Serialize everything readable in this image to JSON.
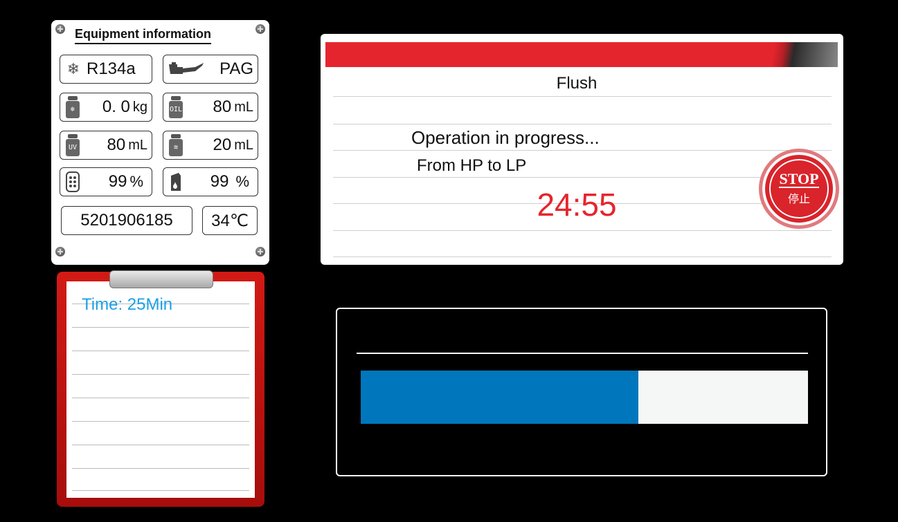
{
  "equipment": {
    "title": "Equipment information",
    "refrigerant": "R134a",
    "oil_type": "PAG",
    "refrigerant_qty": {
      "value": "0. 0",
      "unit": "kg",
      "icon": "refrigerant-bottle-icon"
    },
    "oil_qty": {
      "value": "80",
      "unit": "mL",
      "icon": "oil-bottle-icon",
      "label": "OIL"
    },
    "uv_qty": {
      "value": "80",
      "unit": "mL",
      "icon": "uv-bottle-icon",
      "label": "UV"
    },
    "waste_qty": {
      "value": "20",
      "unit": "mL",
      "icon": "waste-oil-bottle-icon"
    },
    "filter_pct": {
      "value": "99",
      "unit": "%",
      "icon": "filter-icon"
    },
    "pump_pct": {
      "value": "99",
      "unit": "%",
      "icon": "pump-oil-icon"
    },
    "serial": "5201906185",
    "temperature": "34℃"
  },
  "flush": {
    "title": "Flush",
    "status": "Operation in progress...",
    "direction": "From HP to LP",
    "timer": "24:55",
    "stop_label_en": "STOP",
    "stop_label_cn": "停止",
    "timer_color": "#e5252d"
  },
  "clipboard": {
    "time_text": "Time:  25Min"
  },
  "progress": {
    "fraction": 0.62,
    "fill_color": "#0077bd"
  }
}
